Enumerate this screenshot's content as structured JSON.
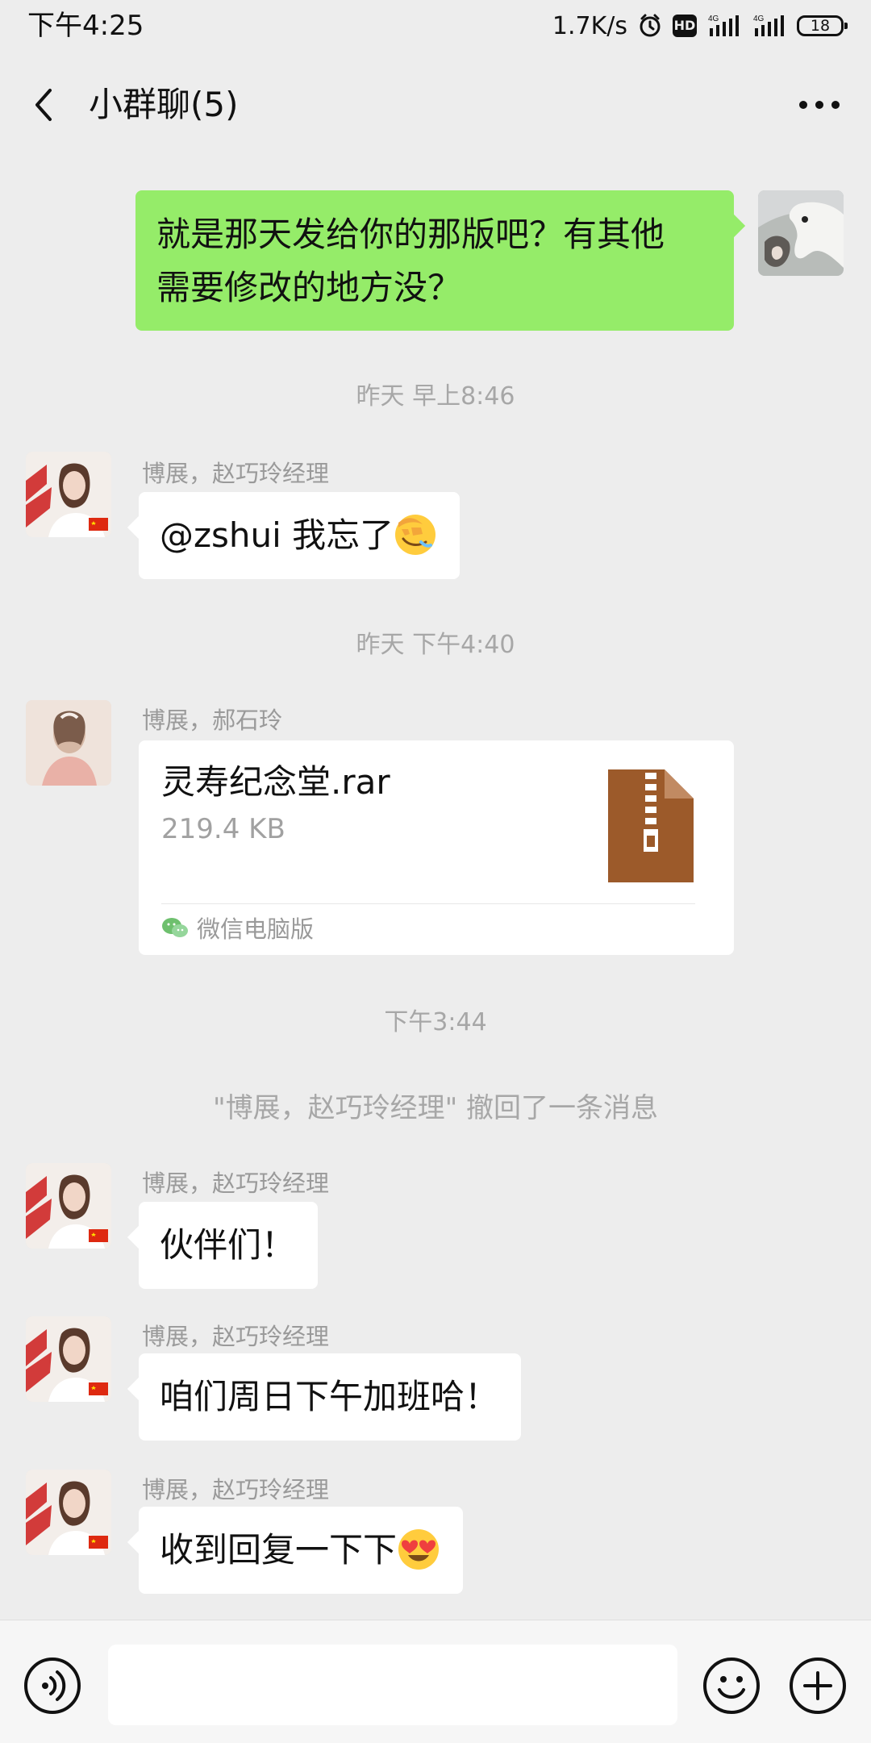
{
  "status_bar": {
    "time": "下午4:25",
    "speed": "1.7K/s",
    "hd_label": "HD",
    "network_1": "4G",
    "network_2": "4G",
    "battery_level": "18"
  },
  "header": {
    "title": "小群聊(5)",
    "back_icon": "chevron-left-icon",
    "more_icon": "more-dots-icon"
  },
  "messages": [
    {
      "id": "msg-self-1",
      "side": "right",
      "text_line_1": "就是那天发给你的那版吧？有其他",
      "text_line_2": "需要修改的地方没？"
    },
    {
      "id": "time-1",
      "type": "timestamp",
      "text": "昨天 早上8:46"
    },
    {
      "id": "msg-zhao-1",
      "side": "left",
      "sender": "博展，赵巧玲经理",
      "text": "@zshui  我忘了",
      "emoji": "face-palm-emoji"
    },
    {
      "id": "time-2",
      "type": "timestamp",
      "text": "昨天 下午4:40"
    },
    {
      "id": "msg-hao-file",
      "side": "left",
      "sender": "博展，郝石玲",
      "file_name": "灵寿纪念堂.rar",
      "file_size": "219.4 KB",
      "source": "微信电脑版"
    },
    {
      "id": "time-3",
      "type": "timestamp",
      "text": "下午3:44"
    },
    {
      "id": "recall-1",
      "type": "system",
      "text": "\"博展，赵巧玲经理\" 撤回了一条消息"
    },
    {
      "id": "msg-zhao-2",
      "side": "left",
      "sender": "博展，赵巧玲经理",
      "text": "伙伴们！"
    },
    {
      "id": "msg-zhao-3",
      "side": "left",
      "sender": "博展，赵巧玲经理",
      "text": "咱们周日下午加班哈！"
    },
    {
      "id": "msg-zhao-4",
      "side": "left",
      "sender": "博展，赵巧玲经理",
      "text": "收到回复一下下",
      "emoji": "heart-eyes-emoji"
    }
  ],
  "input": {
    "value": "",
    "placeholder": "",
    "voice_icon": "voice-icon",
    "emoji_icon": "emoji-icon",
    "plus_icon": "plus-icon"
  },
  "colors": {
    "background": "#ededed",
    "self_bubble": "#95ec69",
    "other_bubble": "#ffffff",
    "file_icon": "#9c5a2a",
    "meta_text": "#a7a7a7"
  }
}
